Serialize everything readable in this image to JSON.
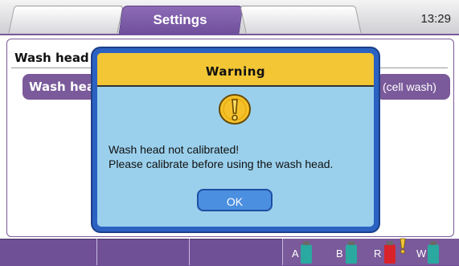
{
  "header": {
    "active_tab": "Settings",
    "clock": "13:29"
  },
  "settings": {
    "section_label": "Wash head",
    "button_left_label": "Wash head",
    "button_right_label": "(cell wash)"
  },
  "dialog": {
    "title": "Warning",
    "icon": "exclamation-icon",
    "message_line1": "Wash head not calibrated!",
    "message_line2": "Please calibrate before using the wash head.",
    "ok_label": "OK"
  },
  "bottom": {
    "bottles": [
      {
        "label": "A",
        "color": "#2aa9a0"
      },
      {
        "label": "B",
        "color": "#2aa9a0"
      },
      {
        "label": "R",
        "color": "#d8232a"
      },
      {
        "label": "W",
        "color": "#2aa9a0"
      }
    ],
    "alert_icon": "warning-exclamation-icon"
  }
}
